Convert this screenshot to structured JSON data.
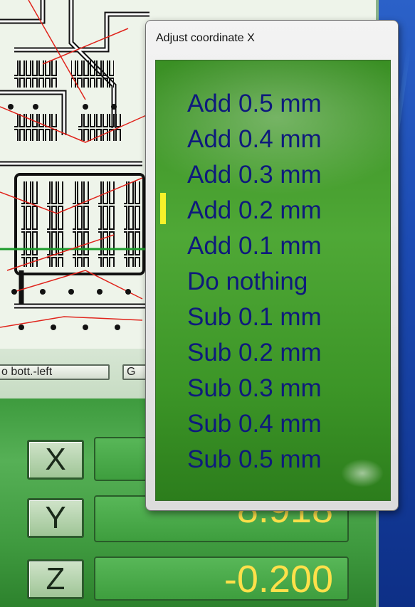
{
  "dialog": {
    "title": "Adjust coordinate X",
    "items": [
      "Add 0.5 mm",
      "Add 0.4 mm",
      "Add 0.3 mm",
      "Add 0.2 mm",
      "Add 0.1 mm",
      "Do nothing",
      "Sub 0.1 mm",
      "Sub 0.2 mm",
      "Sub 0.3 mm",
      "Sub 0.4 mm",
      "Sub 0.5 mm"
    ],
    "selected_item": "Add 0.2 mm"
  },
  "toolbar": {
    "bottom_left_label": "o bott.-left",
    "partial_label": "G"
  },
  "coordinates": {
    "x_label": "X",
    "y_label": "Y",
    "z_label": "Z",
    "y_value": "8.918",
    "z_value": "-0.200"
  },
  "colors": {
    "panel_green": "#4fa836",
    "menu_text": "#0e1a7c",
    "value_yellow": "#ffe04a",
    "selection_marker": "#f6f22a"
  }
}
